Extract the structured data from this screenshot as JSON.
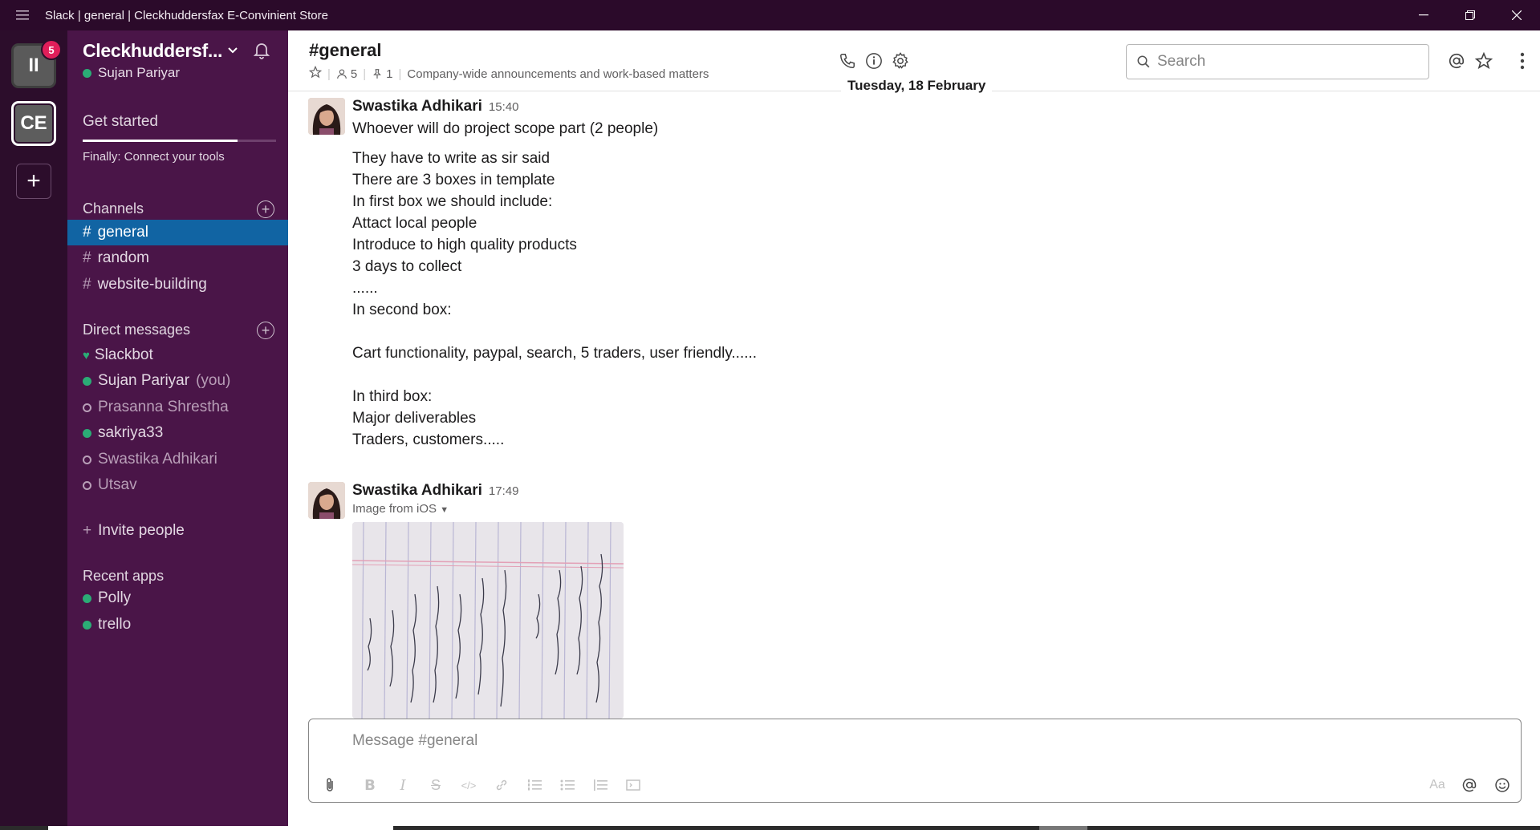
{
  "window": {
    "title": "Slack | general | Cleckhuddersfax E-Convinient Store"
  },
  "rail": {
    "workspaces": [
      {
        "label": "II",
        "badge": "5"
      },
      {
        "label": "CE"
      }
    ],
    "add_label": "+"
  },
  "sidebar": {
    "team_name": "Cleckhuddersf...",
    "user_name": "Sujan Pariyar",
    "get_started": "Get started",
    "get_started_progress": 0.8,
    "finally_text": "Finally: Connect your tools",
    "channels_header": "Channels",
    "channels": [
      {
        "name": "general",
        "active": true
      },
      {
        "name": "random"
      },
      {
        "name": "website-building"
      }
    ],
    "dm_header": "Direct messages",
    "dms": [
      {
        "name": "Slackbot",
        "status": "heart"
      },
      {
        "name": "Sujan Pariyar",
        "suffix": "(you)",
        "status": "online"
      },
      {
        "name": "Prasanna Shrestha",
        "status": "away"
      },
      {
        "name": "sakriya33",
        "status": "online"
      },
      {
        "name": "Swastika Adhikari",
        "status": "away"
      },
      {
        "name": "Utsav",
        "status": "away"
      }
    ],
    "invite_label": "Invite people",
    "recent_apps_header": "Recent apps",
    "apps": [
      {
        "name": "Polly"
      },
      {
        "name": "trello"
      }
    ]
  },
  "header": {
    "channel": "#general",
    "members": "5",
    "pins": "1",
    "topic": "Company-wide announcements and work-based matters",
    "search_placeholder": "Search"
  },
  "day_separator": "Tuesday, 18 February",
  "messages": [
    {
      "author": "Swastika Adhikari",
      "time": "15:40",
      "lines": [
        "Whoever will do project scope part  (2 people)",
        "",
        "They have to write as sir said",
        "There are 3 boxes in template",
        "In first box we should include:",
        "Attact local people",
        "Introduce to high quality products",
        "3 days to collect",
        "......",
        "In second box:",
        "",
        "Cart functionality, paypal, search, 5 traders, user friendly......",
        "",
        "In third box:",
        "Major deliverables",
        "Traders, customers....."
      ]
    },
    {
      "author": "Swastika Adhikari",
      "time": "17:49",
      "attachment_label": "Image from iOS"
    }
  ],
  "composer": {
    "placeholder": "Message #general",
    "format_label": "Aa"
  },
  "colors": {
    "sidebar": "#4a1548",
    "rail": "#2c0d2b",
    "active_channel": "#1164a3",
    "online": "#2bac76",
    "badge": "#e01e5a"
  }
}
